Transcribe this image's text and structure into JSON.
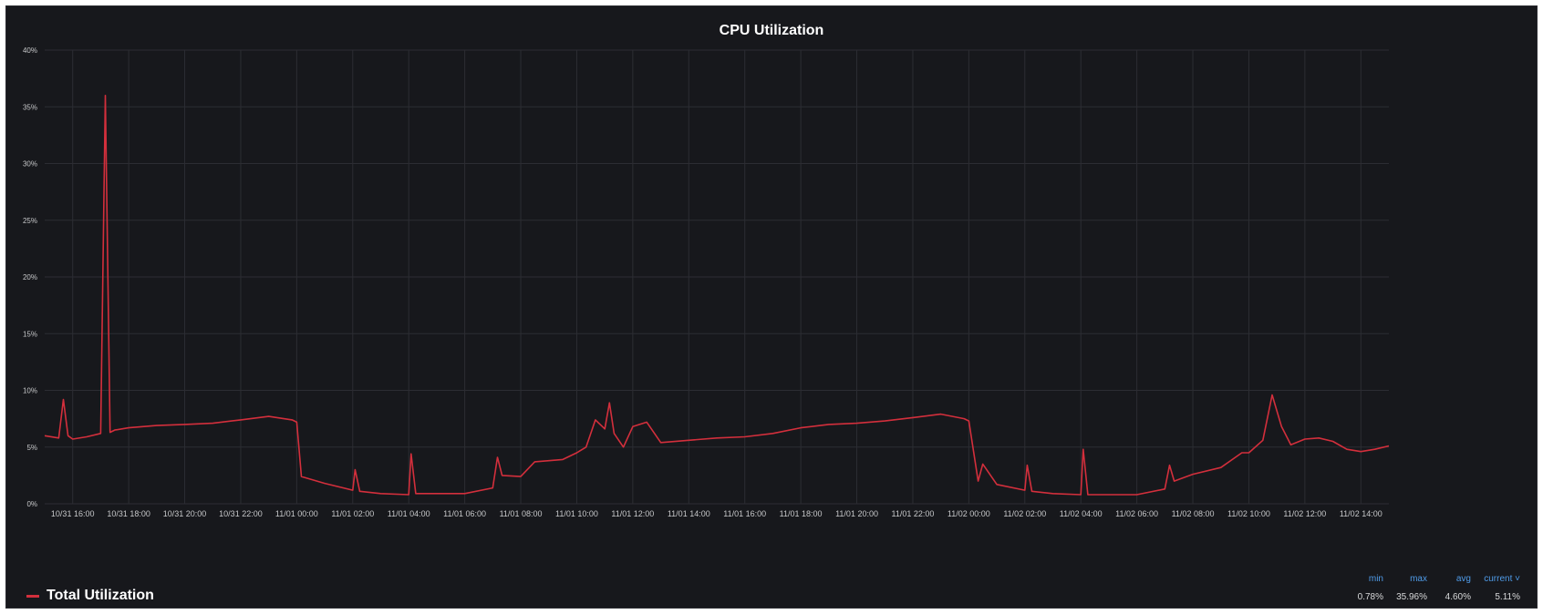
{
  "chart_data": {
    "type": "line",
    "title": "CPU Utilization",
    "xlabel": "",
    "ylabel": "",
    "ylim": [
      0,
      40
    ],
    "y_ticks": [
      "0%",
      "5%",
      "10%",
      "15%",
      "20%",
      "25%",
      "30%",
      "35%",
      "40%"
    ],
    "x_tick_labels": [
      "10/31 16:00",
      "10/31 18:00",
      "10/31 20:00",
      "10/31 22:00",
      "11/01 00:00",
      "11/01 02:00",
      "11/01 04:00",
      "11/01 06:00",
      "11/01 08:00",
      "11/01 10:00",
      "11/01 12:00",
      "11/01 14:00",
      "11/01 16:00",
      "11/01 18:00",
      "11/01 20:00",
      "11/01 22:00",
      "11/02 00:00",
      "11/02 02:00",
      "11/02 04:00",
      "11/02 06:00",
      "11/02 08:00",
      "11/02 10:00",
      "11/02 12:00",
      "11/02 14:00"
    ],
    "grid": true,
    "legend_position": "bottom-left",
    "series": [
      {
        "name": "Total Utilization",
        "color": "#d32f3c",
        "x": [
          "10/31 15:00",
          "10/31 15:30",
          "10/31 15:40",
          "10/31 15:50",
          "10/31 16:00",
          "10/31 16:30",
          "10/31 17:00",
          "10/31 17:10",
          "10/31 17:20",
          "10/31 17:30",
          "10/31 18:00",
          "10/31 19:00",
          "10/31 20:00",
          "10/31 21:00",
          "10/31 22:00",
          "10/31 23:00",
          "10/31 23:50",
          "11/01 00:00",
          "11/01 00:10",
          "11/01 01:00",
          "11/01 02:00",
          "11/01 02:05",
          "11/01 02:15",
          "11/01 03:00",
          "11/01 04:00",
          "11/01 04:05",
          "11/01 04:15",
          "11/01 05:00",
          "11/01 06:00",
          "11/01 07:00",
          "11/01 07:10",
          "11/01 07:20",
          "11/01 08:00",
          "11/01 08:30",
          "11/01 09:00",
          "11/01 09:30",
          "11/01 10:00",
          "11/01 10:20",
          "11/01 10:40",
          "11/01 11:00",
          "11/01 11:10",
          "11/01 11:20",
          "11/01 11:40",
          "11/01 12:00",
          "11/01 12:30",
          "11/01 13:00",
          "11/01 14:00",
          "11/01 15:00",
          "11/01 16:00",
          "11/01 17:00",
          "11/01 18:00",
          "11/01 19:00",
          "11/01 20:00",
          "11/01 21:00",
          "11/01 22:00",
          "11/01 23:00",
          "11/01 23:50",
          "11/02 00:00",
          "11/02 00:20",
          "11/02 00:30",
          "11/02 01:00",
          "11/02 02:00",
          "11/02 02:05",
          "11/02 02:15",
          "11/02 03:00",
          "11/02 04:00",
          "11/02 04:05",
          "11/02 04:15",
          "11/02 05:00",
          "11/02 06:00",
          "11/02 07:00",
          "11/02 07:10",
          "11/02 07:20",
          "11/02 08:00",
          "11/02 09:00",
          "11/02 09:45",
          "11/02 10:00",
          "11/02 10:30",
          "11/02 10:50",
          "11/02 11:10",
          "11/02 11:30",
          "11/02 12:00",
          "11/02 12:30",
          "11/02 13:00",
          "11/02 13:30",
          "11/02 14:00",
          "11/02 14:30",
          "11/02 15:00"
        ],
        "values": [
          6.0,
          5.8,
          9.2,
          6.0,
          5.7,
          5.9,
          6.2,
          36.0,
          6.3,
          6.5,
          6.7,
          6.9,
          7.0,
          7.1,
          7.4,
          7.7,
          7.4,
          7.2,
          2.4,
          1.8,
          1.2,
          3.0,
          1.1,
          0.9,
          0.8,
          4.4,
          0.9,
          0.9,
          0.9,
          1.4,
          4.1,
          2.5,
          2.4,
          3.7,
          3.8,
          3.9,
          4.5,
          5.0,
          7.4,
          6.6,
          8.9,
          6.2,
          5.0,
          6.8,
          7.2,
          5.4,
          5.6,
          5.8,
          5.9,
          6.2,
          6.7,
          7.0,
          7.1,
          7.3,
          7.6,
          7.9,
          7.5,
          7.3,
          2.0,
          3.5,
          1.7,
          1.2,
          3.4,
          1.1,
          0.9,
          0.8,
          4.8,
          0.8,
          0.8,
          0.8,
          1.3,
          3.4,
          2.0,
          2.6,
          3.2,
          4.5,
          4.5,
          5.6,
          9.6,
          6.8,
          5.2,
          5.7,
          5.8,
          5.5,
          4.8,
          4.6,
          4.8,
          5.1
        ]
      }
    ],
    "stats": {
      "headers": [
        "min",
        "max",
        "avg",
        "current ˅"
      ],
      "values": [
        "0.78%",
        "35.96%",
        "4.60%",
        "5.11%"
      ]
    }
  }
}
